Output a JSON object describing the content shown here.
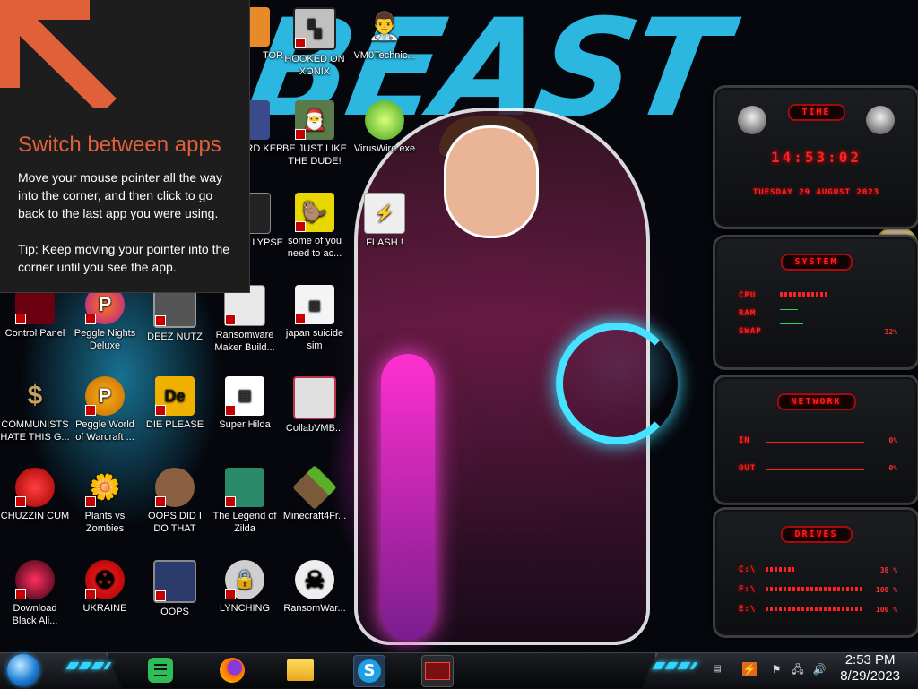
{
  "tip": {
    "title": "Switch between apps",
    "body": "Move your mouse pointer all the way into the corner, and then click to go back to the last app you were using.",
    "tip": "Tip: Keep moving your pointer into the corner until you see the app."
  },
  "desktop_icons": [
    {
      "label": "TOR"
    },
    {
      "label": "HOOKED ON XONIX"
    },
    {
      "label": "VM0Technic..."
    },
    {
      "label": "BOARD KER"
    },
    {
      "label": "BE JUST LIKE THE DUDE!"
    },
    {
      "label": "VirusWire.exe"
    },
    {
      "label": "LYPSE"
    },
    {
      "label": "some of you need to ac..."
    },
    {
      "label": "FLASH !"
    },
    {
      "label": "Control Panel"
    },
    {
      "label": "Peggle Nights Deluxe"
    },
    {
      "label": "DEEZ NUTZ"
    },
    {
      "label": "Ransomware Maker Build..."
    },
    {
      "label": "japan suicide sim"
    },
    {
      "label": "COMMUNISTS HATE THIS G..."
    },
    {
      "label": "Peggle World of Warcraft ..."
    },
    {
      "label": "DIE PLEASE"
    },
    {
      "label": "Super Hilda"
    },
    {
      "label": "CollabVMB..."
    },
    {
      "label": "CHUZZIN CUM"
    },
    {
      "label": "Plants vs Zombies"
    },
    {
      "label": "OOPS DID I DO THAT"
    },
    {
      "label": "The Legend of Zilda"
    },
    {
      "label": "Minecraft4Fr..."
    },
    {
      "label": "Download Black Ali..."
    },
    {
      "label": "UKRAINE"
    },
    {
      "label": "OOPS"
    },
    {
      "label": "LYNCHING"
    },
    {
      "label": "RansomWar..."
    }
  ],
  "wallpaper": {
    "text": "BEAST"
  },
  "gadget": {
    "time": {
      "title": "TIME",
      "clock": "14:53:02",
      "date": "TUESDAY 29 AUGUST 2023"
    },
    "system": {
      "title": "SYSTEM",
      "cpu": "CPU",
      "ram": "RAM",
      "swap": "SWAP",
      "swap_pct": "32%"
    },
    "network": {
      "title": "NETWORK",
      "in": "IN",
      "in_pct": "0%",
      "out": "OUT",
      "out_pct": "0%"
    },
    "drives": {
      "title": "DRIVES",
      "c": "C:\\",
      "c_pct": "38 %",
      "f": "F:\\",
      "f_pct": "100 %",
      "e": "E:\\",
      "e_pct": "100 %"
    }
  },
  "taskbar": {
    "pinned": [
      "spotify-icon",
      "firefox-icon",
      "file-explorer-icon",
      "skype-icon",
      "app-window-icon"
    ],
    "clock_time": "2:53 PM",
    "clock_date": "8/29/2023"
  },
  "colors": {
    "accent_red": "#ff2020",
    "tip_orange": "#e0603a",
    "cyan": "#2fd6ff"
  }
}
